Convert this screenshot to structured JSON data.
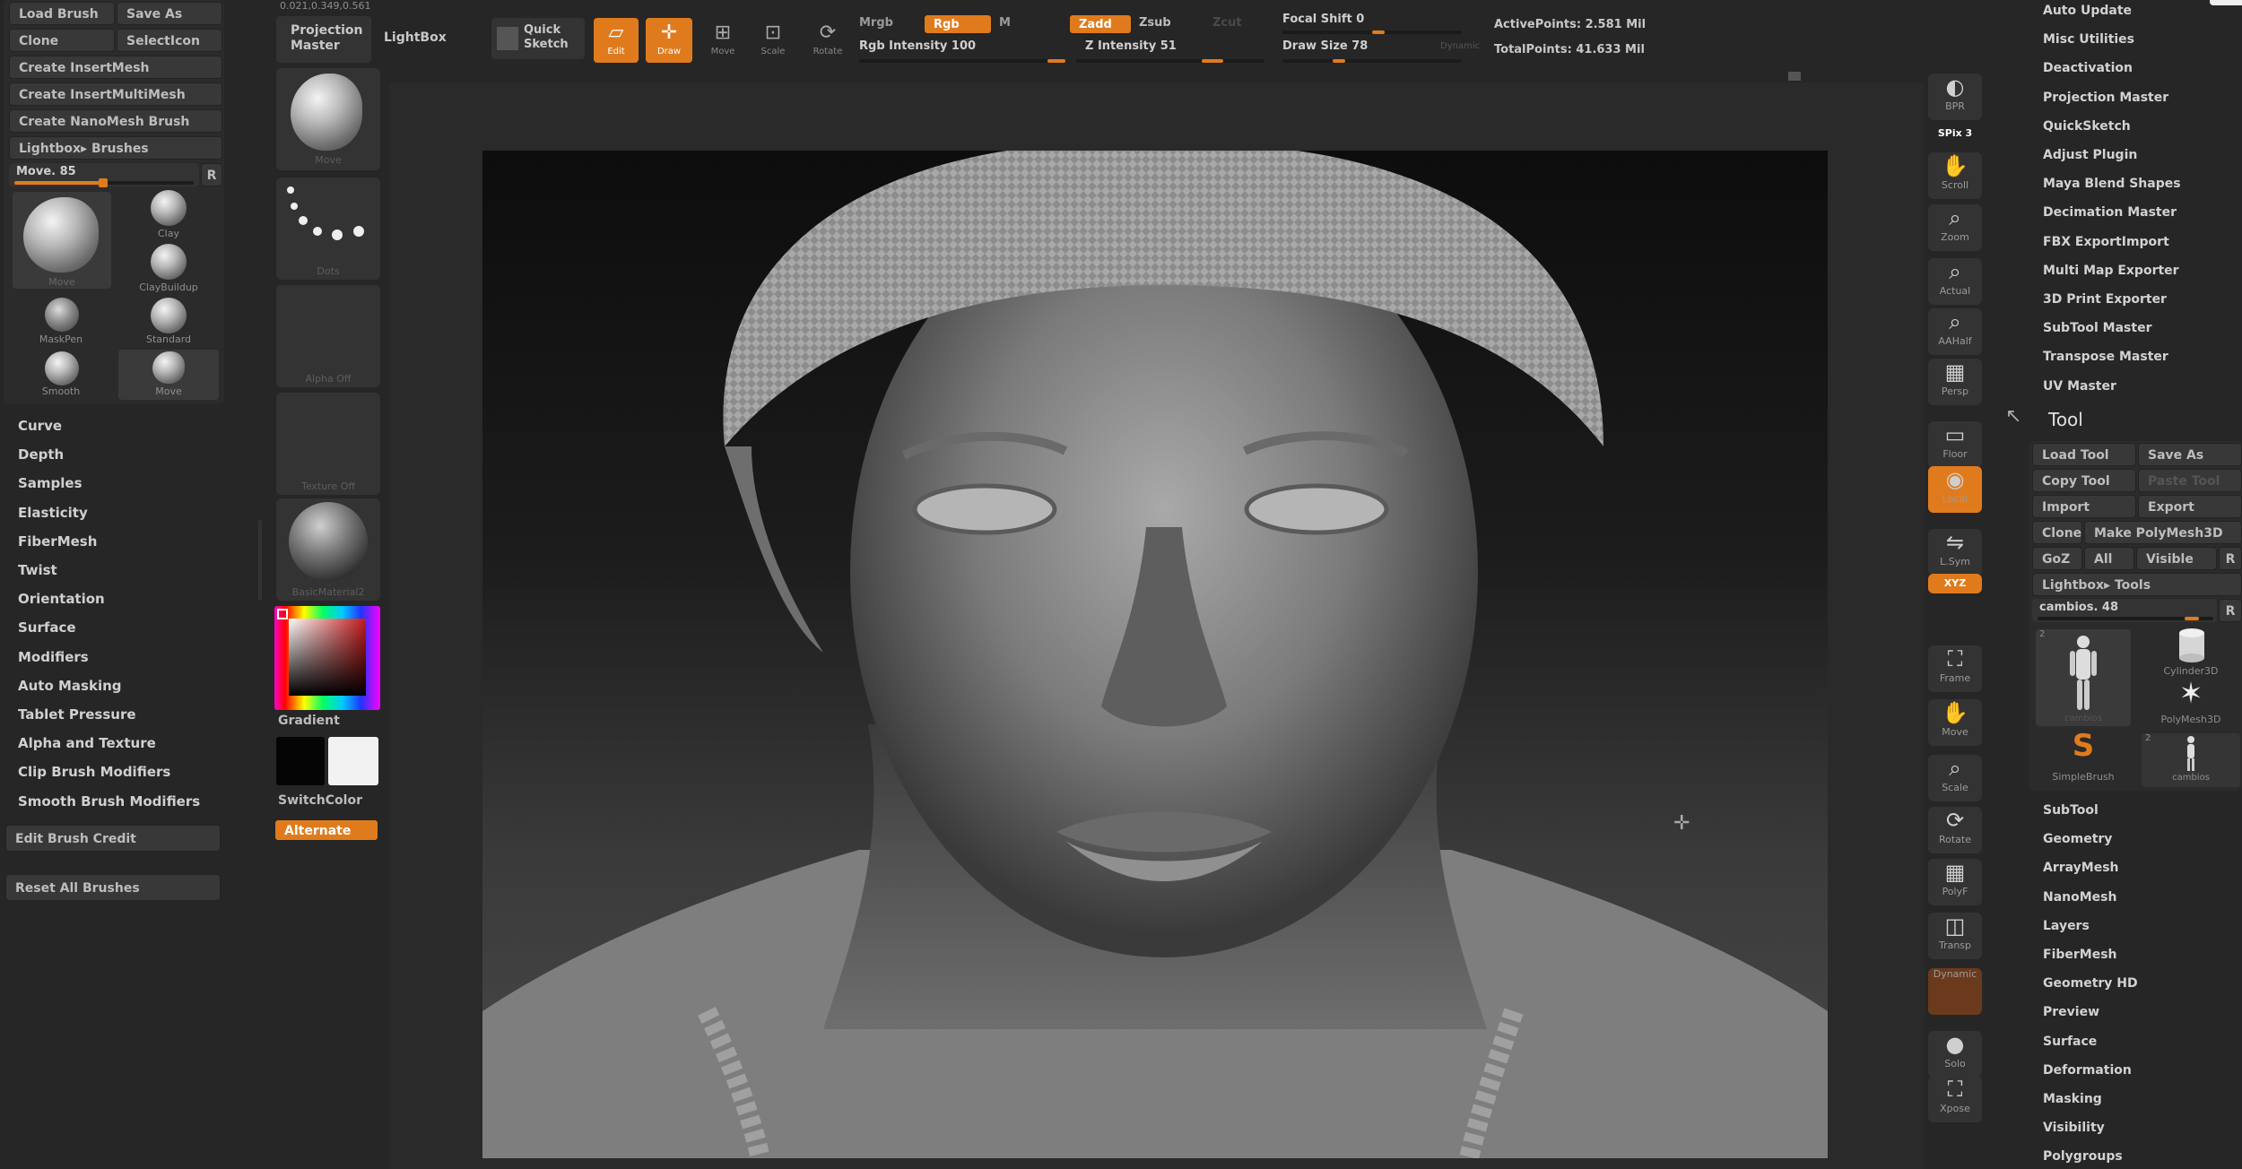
{
  "top_left_coords": "0.021,0.349,0.561",
  "left_panel": {
    "buttons": {
      "load_brush": "Load Brush",
      "save_as": "Save As",
      "clone": "Clone",
      "select_icon": "SelectIcon",
      "create_insertmesh": "Create InsertMesh",
      "create_insertmultimesh": "Create InsertMultiMesh",
      "create_nanomesh_brush": "Create NanoMesh Brush",
      "lightbox_brushes": "Lightbox▸ Brushes"
    },
    "move_slider": {
      "label": "Move. 85",
      "value": 85,
      "reset": "R"
    },
    "brushes": [
      {
        "label": "Move"
      },
      {
        "label": "Clay"
      },
      {
        "label": "ClayBuildup"
      },
      {
        "label": "MaskPen"
      },
      {
        "label": "Standard"
      },
      {
        "label": "Smooth"
      },
      {
        "label": "Move"
      }
    ],
    "sections": [
      "Curve",
      "Depth",
      "Samples",
      "Elasticity",
      "FiberMesh",
      "Twist",
      "Orientation",
      "Surface",
      "Modifiers",
      "Auto Masking",
      "Tablet Pressure",
      "Alpha and Texture",
      "Clip Brush Modifiers",
      "Smooth Brush Modifiers"
    ],
    "edit_brush_credit": "Edit Brush Credit",
    "reset_all_brushes": "Reset All Brushes"
  },
  "shelf": {
    "brush_thumb_label": "Move",
    "stroke_label": "Dots",
    "alpha_label": "Alpha Off",
    "texture_label": "Texture Off",
    "material_label": "BasicMaterial2",
    "gradient_label": "Gradient",
    "switchcolor_label": "SwitchColor",
    "alternate_label": "Alternate"
  },
  "toolbar": {
    "projection_master": "Projection\nMaster",
    "lightbox": "LightBox",
    "quick_sketch": "Quick\nSketch",
    "edit": "Edit",
    "draw": "Draw",
    "move": "Move",
    "scale": "Scale",
    "rotate": "Rotate",
    "mrgb": "Mrgb",
    "rgb": "Rgb",
    "m": "M",
    "rgb_intensity": "Rgb Intensity 100",
    "rgb_intensity_value": 100,
    "zadd": "Zadd",
    "zsub": "Zsub",
    "zcut": "Zcut",
    "z_intensity": "Z Intensity 51",
    "z_intensity_value": 51,
    "focal_shift": "Focal Shift 0",
    "focal_shift_value": 0,
    "draw_size": "Draw Size 78",
    "draw_size_value": 78,
    "dynamic": "Dynamic",
    "active_points": "ActivePoints: 2.581 Mil",
    "total_points": "TotalPoints: 41.633 Mil"
  },
  "right_nav": [
    {
      "icon": "bpr-icon",
      "label": "BPR"
    },
    {
      "icon": "spix-icon",
      "label": "SPix 3"
    },
    {
      "icon": "scroll-icon",
      "label": "Scroll"
    },
    {
      "icon": "zoom-icon",
      "label": "Zoom"
    },
    {
      "icon": "actual-icon",
      "label": "Actual"
    },
    {
      "icon": "aahalf-icon",
      "label": "AAHalf"
    },
    {
      "icon": "persp-icon",
      "label": "Persp"
    },
    {
      "icon": "floor-icon",
      "label": "Floor"
    },
    {
      "icon": "local-icon",
      "label": "Local"
    },
    {
      "icon": "lsym-icon",
      "label": "L.Sym"
    },
    {
      "icon": "xyz-icon",
      "label": "XYZ"
    },
    {
      "icon": "frame-icon",
      "label": "Frame"
    },
    {
      "icon": "move-icon",
      "label": "Move"
    },
    {
      "icon": "scale-icon",
      "label": "Scale"
    },
    {
      "icon": "rotate-icon",
      "label": "Rotate"
    },
    {
      "icon": "polyf-icon",
      "label": "PolyF"
    },
    {
      "icon": "transp-icon",
      "label": "Transp"
    },
    {
      "icon": "ghost-icon",
      "label": "Dynamic"
    },
    {
      "icon": "solo-icon",
      "label": "Solo"
    },
    {
      "icon": "xpose-icon",
      "label": "Xpose"
    }
  ],
  "right_panel": {
    "plugins": [
      "Auto Update",
      "Misc Utilities",
      "Deactivation",
      "Projection Master",
      "QuickSketch",
      "Adjust Plugin",
      "Maya Blend Shapes",
      "Decimation Master",
      "FBX ExportImport",
      "Multi Map Exporter",
      "3D Print Exporter",
      "SubTool Master",
      "Transpose Master",
      "UV Master"
    ],
    "tool_header": "Tool",
    "tool_buttons": {
      "load_tool": "Load Tool",
      "save_as": "Save As",
      "copy_tool": "Copy Tool",
      "paste_tool": "Paste Tool",
      "import": "Import",
      "export": "Export",
      "clone": "Clone",
      "make_polymesh3d": "Make PolyMesh3D",
      "goz": "GoZ",
      "all": "All",
      "visible": "Visible",
      "r": "R",
      "lightbox_tools": "Lightbox▸ Tools"
    },
    "tool_slider": {
      "label": "cambios. 48",
      "value": 48,
      "reset": "R"
    },
    "tools": [
      {
        "label": "cambios",
        "count": "2"
      },
      {
        "label": "Cylinder3D"
      },
      {
        "label": "PolyMesh3D"
      },
      {
        "label": "SimpleBrush"
      },
      {
        "label": "cambios",
        "count": "2"
      }
    ],
    "sections": [
      "SubTool",
      "Geometry",
      "ArrayMesh",
      "NanoMesh",
      "Layers",
      "FiberMesh",
      "Geometry HD",
      "Preview",
      "Surface",
      "Deformation",
      "Masking",
      "Visibility",
      "Polygroups"
    ]
  },
  "colors": {
    "accent": "#e07b1d",
    "bg": "#262626",
    "panel": "#2e2e2e",
    "button": "#383838"
  }
}
